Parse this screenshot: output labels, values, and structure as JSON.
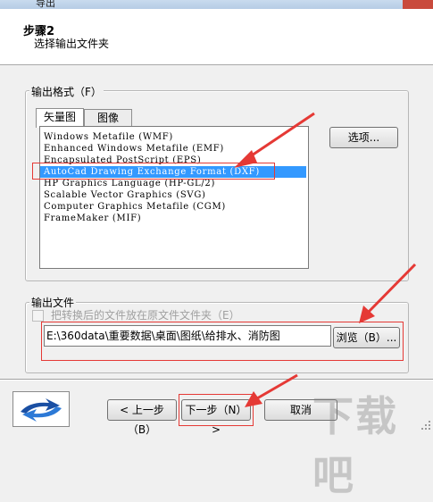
{
  "window": {
    "title": "导出"
  },
  "header": {
    "step_title": "步骤2",
    "step_desc": "选择输出文件夹"
  },
  "output_format": {
    "group_label": "输出格式（F）",
    "tabs": [
      {
        "label": "矢量图"
      },
      {
        "label": "图像"
      }
    ],
    "items": [
      {
        "label": "Windows Metafile (WMF)"
      },
      {
        "label": "Enhanced Windows Metafile (EMF)"
      },
      {
        "label": "Encapsulated PostScript (EPS)"
      },
      {
        "label": "AutoCad Drawing Exchange Format (DXF)",
        "selected": true
      },
      {
        "label": "HP Graphics Language (HP-GL/2)"
      },
      {
        "label": "Scalable Vector Graphics (SVG)"
      },
      {
        "label": "Computer Graphics Metafile (CGM)"
      },
      {
        "label": "FrameMaker (MIF)"
      }
    ],
    "options_button": "选项..."
  },
  "output_file": {
    "group_label": "输出文件",
    "checkbox_label": "把转换后的文件放在原文件文件夹（E）",
    "checkbox_checked": false,
    "path": "E:\\360data\\重要数据\\桌面\\图纸\\给排水、消防图",
    "browse_button": "浏览（B）..."
  },
  "footer": {
    "back_button": "< 上一步（B）",
    "next_button": "下一步（N） >",
    "cancel_button": "取消"
  },
  "watermark": "下载吧",
  "colors": {
    "selection": "#3399ff",
    "annotation": "#e53935"
  }
}
